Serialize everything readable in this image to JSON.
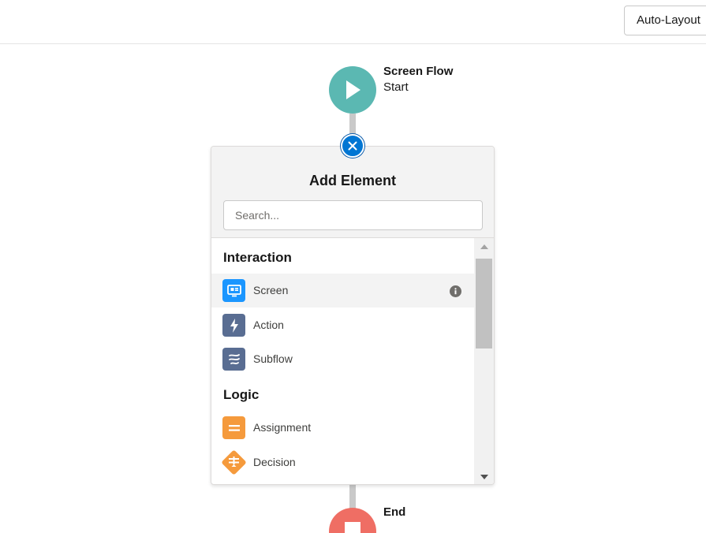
{
  "toolbar": {
    "auto_layout_label": "Auto-Layout"
  },
  "flow": {
    "start_title": "Screen Flow",
    "start_subtitle": "Start",
    "end_title": "End"
  },
  "add_element": {
    "title": "Add Element",
    "search_placeholder": "Search...",
    "sections": [
      {
        "heading": "Interaction",
        "items": [
          {
            "label": "Screen",
            "icon": "screen-icon",
            "color": "#1b96ff",
            "highlighted": true,
            "has_info": true
          },
          {
            "label": "Action",
            "icon": "lightning-icon",
            "color": "#596d92"
          },
          {
            "label": "Subflow",
            "icon": "subflow-icon",
            "color": "#596d92"
          }
        ]
      },
      {
        "heading": "Logic",
        "items": [
          {
            "label": "Assignment",
            "icon": "assignment-icon",
            "color": "#f59a3c"
          },
          {
            "label": "Decision",
            "icon": "decision-icon",
            "color": "#f59a3c"
          }
        ]
      }
    ]
  },
  "colors": {
    "start_node": "#5bb8b2",
    "end_node": "#ef6e64",
    "close_button": "#0176d3"
  }
}
